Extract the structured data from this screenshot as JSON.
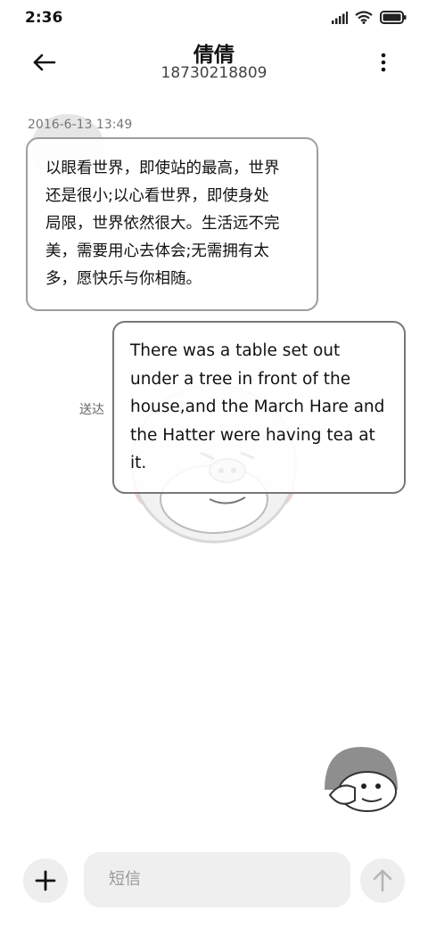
{
  "status_bar": {
    "time": "2:36",
    "icons": [
      "signal-icon",
      "wifi-icon",
      "battery-icon"
    ]
  },
  "header": {
    "contact_name": "倩倩",
    "contact_number": "18730218809",
    "back_icon": "back-arrow-icon",
    "more_icon": "more-vertical-icon"
  },
  "conversation": {
    "timestamp": "2016-6-13 13:49",
    "messages": [
      {
        "direction": "incoming",
        "lines": [
          "以眼看世界，即使站的最高，世界",
          "还是很小;以心看世界，即使身处",
          "局限，世界依然很大。生活远不完",
          "美，需要用心去体会;无需拥有太",
          "多，愿快乐与你相随。"
        ]
      },
      {
        "direction": "outgoing",
        "status": "送达",
        "lines": [
          "There was a table set out",
          "under a tree in front of the",
          "house,and the March Hare and",
          "the Hatter were having tea at",
          "it."
        ]
      }
    ]
  },
  "composer": {
    "placeholder": "短信",
    "add_icon": "plus-icon",
    "send_icon": "send-arrow-icon"
  },
  "colors": {
    "bubble_in_border": "#9e9e9e",
    "bubble_out_border": "#777777",
    "input_bg": "#efefef"
  }
}
